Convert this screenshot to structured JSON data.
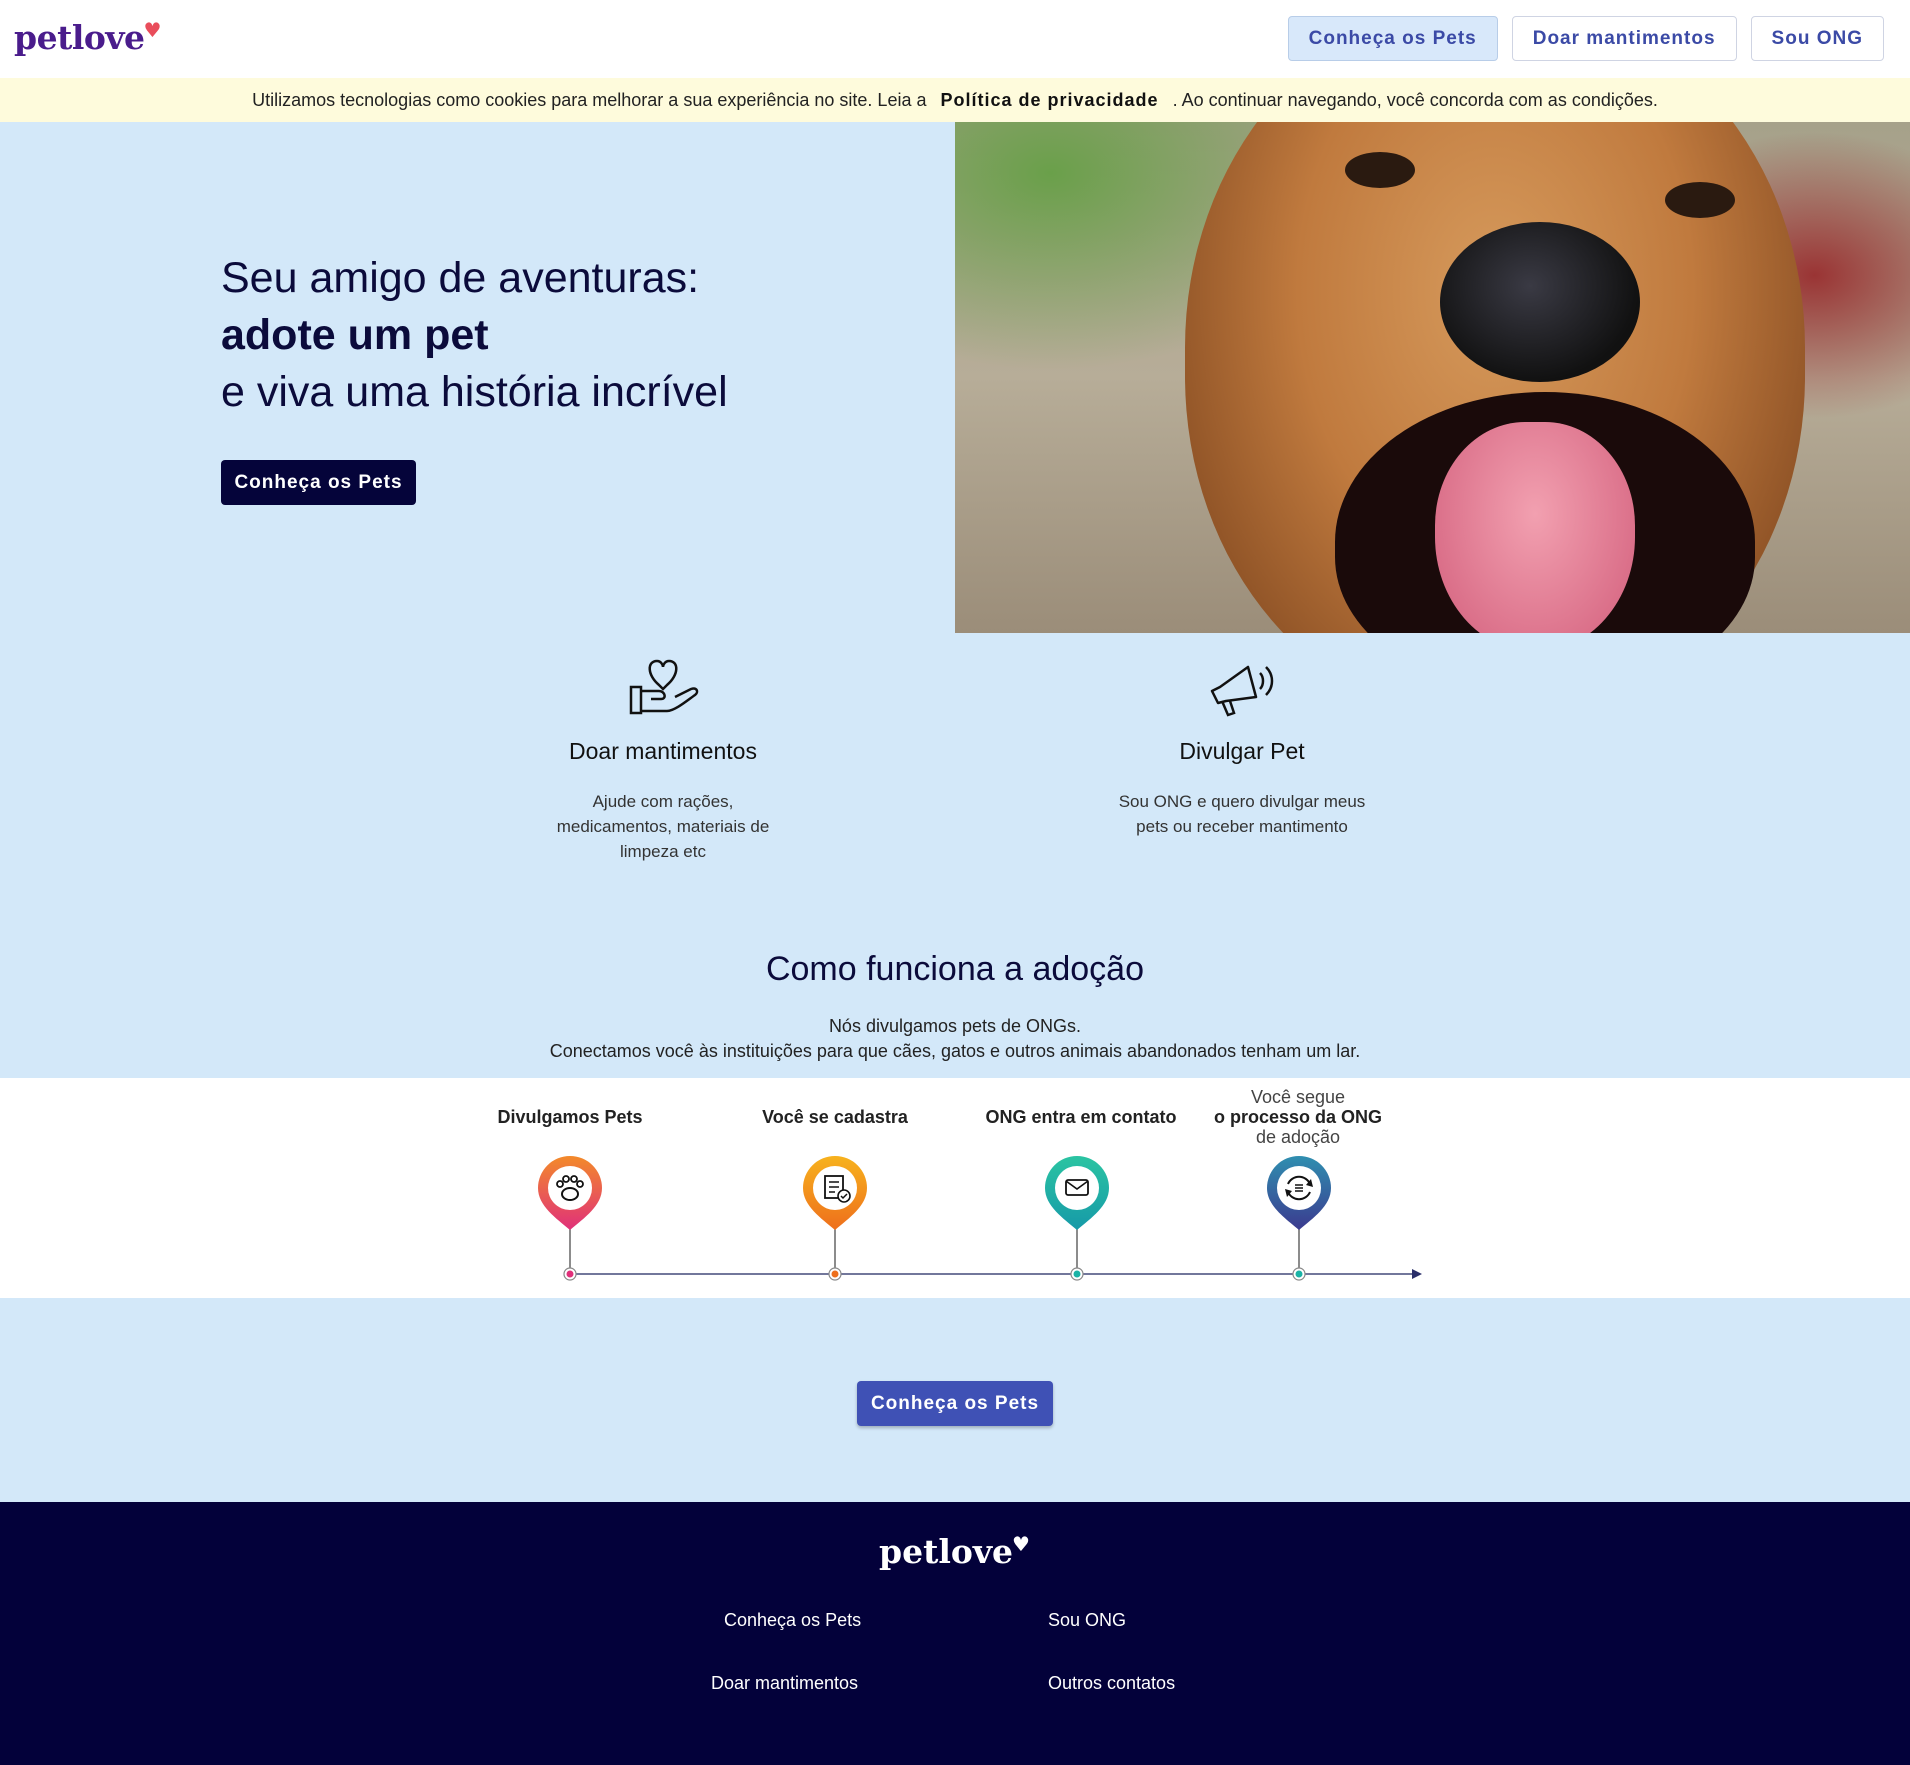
{
  "header": {
    "logo": "petlove",
    "nav": [
      "Conheça os Pets",
      "Doar mantimentos",
      "Sou ONG"
    ]
  },
  "cookie": {
    "before": "Utilizamos tecnologias como cookies para melhorar a sua experiência no site. Leia a",
    "link": "Política de privacidade",
    "after": ". Ao continuar navegando, você concorda com as condições."
  },
  "hero": {
    "line1": "Seu amigo de aventuras:",
    "line2": "adote um pet",
    "line3": "e viva uma história incrível",
    "button": "Conheça os Pets"
  },
  "features": [
    {
      "title": "Doar mantimentos",
      "desc": "Ajude com rações, medicamentos, materiais de limpeza etc",
      "icon": "hand-heart-icon"
    },
    {
      "title": "Divulgar Pet",
      "desc": "Sou ONG e quero divulgar meus pets ou receber mantimento",
      "icon": "megaphone-icon"
    }
  ],
  "how": {
    "title": "Como funciona a adoção",
    "desc1": "Nós divulgamos pets de ONGs.",
    "desc2": "Conectamos você às instituições para que cães, gatos e outros animais abandonados tenham um lar.",
    "steps": [
      {
        "label": "Divulgamos Pets",
        "color": "#e8356b",
        "icon": "paw-icon"
      },
      {
        "label": "Você se cadastra",
        "color": "#f08a1c",
        "icon": "form-icon"
      },
      {
        "label": "ONG entra em contato",
        "color": "#1ab3a6",
        "icon": "mail-icon"
      },
      {
        "label_top": "Você segue",
        "label_mid": "o processo da ONG",
        "label_bot": "de adoção",
        "color": "#3a4a9c",
        "icon": "process-icon"
      }
    ]
  },
  "cta": {
    "button": "Conheça os Pets"
  },
  "footer": {
    "logo": "petlove",
    "links": [
      "Conheça os Pets",
      "Sou ONG",
      "Doar mantimentos",
      "Outros contatos"
    ]
  },
  "colors": {
    "primary": "#05043a",
    "accent": "#3f51b5",
    "background": "#d3e8f9",
    "logo": "#4a1c8c",
    "heart": "#e94d5b"
  }
}
